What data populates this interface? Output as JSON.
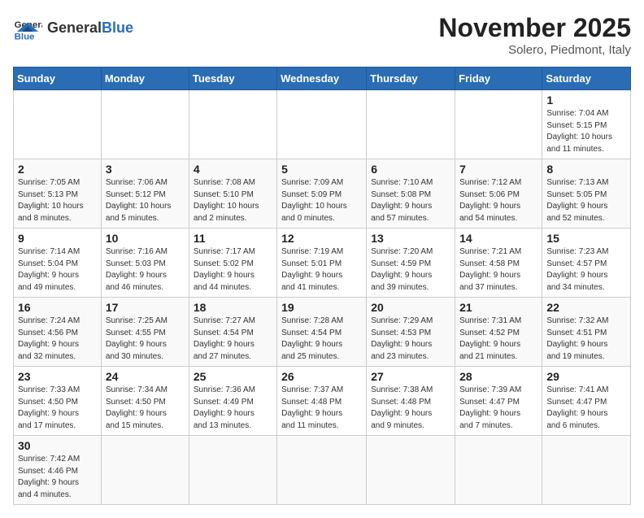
{
  "header": {
    "logo_general": "General",
    "logo_blue": "Blue",
    "month_title": "November 2025",
    "location": "Solero, Piedmont, Italy"
  },
  "weekdays": [
    "Sunday",
    "Monday",
    "Tuesday",
    "Wednesday",
    "Thursday",
    "Friday",
    "Saturday"
  ],
  "weeks": [
    [
      {
        "day": "",
        "info": ""
      },
      {
        "day": "",
        "info": ""
      },
      {
        "day": "",
        "info": ""
      },
      {
        "day": "",
        "info": ""
      },
      {
        "day": "",
        "info": ""
      },
      {
        "day": "",
        "info": ""
      },
      {
        "day": "1",
        "info": "Sunrise: 7:04 AM\nSunset: 5:15 PM\nDaylight: 10 hours\nand 11 minutes."
      }
    ],
    [
      {
        "day": "2",
        "info": "Sunrise: 7:05 AM\nSunset: 5:13 PM\nDaylight: 10 hours\nand 8 minutes."
      },
      {
        "day": "3",
        "info": "Sunrise: 7:06 AM\nSunset: 5:12 PM\nDaylight: 10 hours\nand 5 minutes."
      },
      {
        "day": "4",
        "info": "Sunrise: 7:08 AM\nSunset: 5:10 PM\nDaylight: 10 hours\nand 2 minutes."
      },
      {
        "day": "5",
        "info": "Sunrise: 7:09 AM\nSunset: 5:09 PM\nDaylight: 10 hours\nand 0 minutes."
      },
      {
        "day": "6",
        "info": "Sunrise: 7:10 AM\nSunset: 5:08 PM\nDaylight: 9 hours\nand 57 minutes."
      },
      {
        "day": "7",
        "info": "Sunrise: 7:12 AM\nSunset: 5:06 PM\nDaylight: 9 hours\nand 54 minutes."
      },
      {
        "day": "8",
        "info": "Sunrise: 7:13 AM\nSunset: 5:05 PM\nDaylight: 9 hours\nand 52 minutes."
      }
    ],
    [
      {
        "day": "9",
        "info": "Sunrise: 7:14 AM\nSunset: 5:04 PM\nDaylight: 9 hours\nand 49 minutes."
      },
      {
        "day": "10",
        "info": "Sunrise: 7:16 AM\nSunset: 5:03 PM\nDaylight: 9 hours\nand 46 minutes."
      },
      {
        "day": "11",
        "info": "Sunrise: 7:17 AM\nSunset: 5:02 PM\nDaylight: 9 hours\nand 44 minutes."
      },
      {
        "day": "12",
        "info": "Sunrise: 7:19 AM\nSunset: 5:01 PM\nDaylight: 9 hours\nand 41 minutes."
      },
      {
        "day": "13",
        "info": "Sunrise: 7:20 AM\nSunset: 4:59 PM\nDaylight: 9 hours\nand 39 minutes."
      },
      {
        "day": "14",
        "info": "Sunrise: 7:21 AM\nSunset: 4:58 PM\nDaylight: 9 hours\nand 37 minutes."
      },
      {
        "day": "15",
        "info": "Sunrise: 7:23 AM\nSunset: 4:57 PM\nDaylight: 9 hours\nand 34 minutes."
      }
    ],
    [
      {
        "day": "16",
        "info": "Sunrise: 7:24 AM\nSunset: 4:56 PM\nDaylight: 9 hours\nand 32 minutes."
      },
      {
        "day": "17",
        "info": "Sunrise: 7:25 AM\nSunset: 4:55 PM\nDaylight: 9 hours\nand 30 minutes."
      },
      {
        "day": "18",
        "info": "Sunrise: 7:27 AM\nSunset: 4:54 PM\nDaylight: 9 hours\nand 27 minutes."
      },
      {
        "day": "19",
        "info": "Sunrise: 7:28 AM\nSunset: 4:54 PM\nDaylight: 9 hours\nand 25 minutes."
      },
      {
        "day": "20",
        "info": "Sunrise: 7:29 AM\nSunset: 4:53 PM\nDaylight: 9 hours\nand 23 minutes."
      },
      {
        "day": "21",
        "info": "Sunrise: 7:31 AM\nSunset: 4:52 PM\nDaylight: 9 hours\nand 21 minutes."
      },
      {
        "day": "22",
        "info": "Sunrise: 7:32 AM\nSunset: 4:51 PM\nDaylight: 9 hours\nand 19 minutes."
      }
    ],
    [
      {
        "day": "23",
        "info": "Sunrise: 7:33 AM\nSunset: 4:50 PM\nDaylight: 9 hours\nand 17 minutes."
      },
      {
        "day": "24",
        "info": "Sunrise: 7:34 AM\nSunset: 4:50 PM\nDaylight: 9 hours\nand 15 minutes."
      },
      {
        "day": "25",
        "info": "Sunrise: 7:36 AM\nSunset: 4:49 PM\nDaylight: 9 hours\nand 13 minutes."
      },
      {
        "day": "26",
        "info": "Sunrise: 7:37 AM\nSunset: 4:48 PM\nDaylight: 9 hours\nand 11 minutes."
      },
      {
        "day": "27",
        "info": "Sunrise: 7:38 AM\nSunset: 4:48 PM\nDaylight: 9 hours\nand 9 minutes."
      },
      {
        "day": "28",
        "info": "Sunrise: 7:39 AM\nSunset: 4:47 PM\nDaylight: 9 hours\nand 7 minutes."
      },
      {
        "day": "29",
        "info": "Sunrise: 7:41 AM\nSunset: 4:47 PM\nDaylight: 9 hours\nand 6 minutes."
      }
    ],
    [
      {
        "day": "30",
        "info": "Sunrise: 7:42 AM\nSunset: 4:46 PM\nDaylight: 9 hours\nand 4 minutes."
      },
      {
        "day": "",
        "info": ""
      },
      {
        "day": "",
        "info": ""
      },
      {
        "day": "",
        "info": ""
      },
      {
        "day": "",
        "info": ""
      },
      {
        "day": "",
        "info": ""
      },
      {
        "day": "",
        "info": ""
      }
    ]
  ]
}
